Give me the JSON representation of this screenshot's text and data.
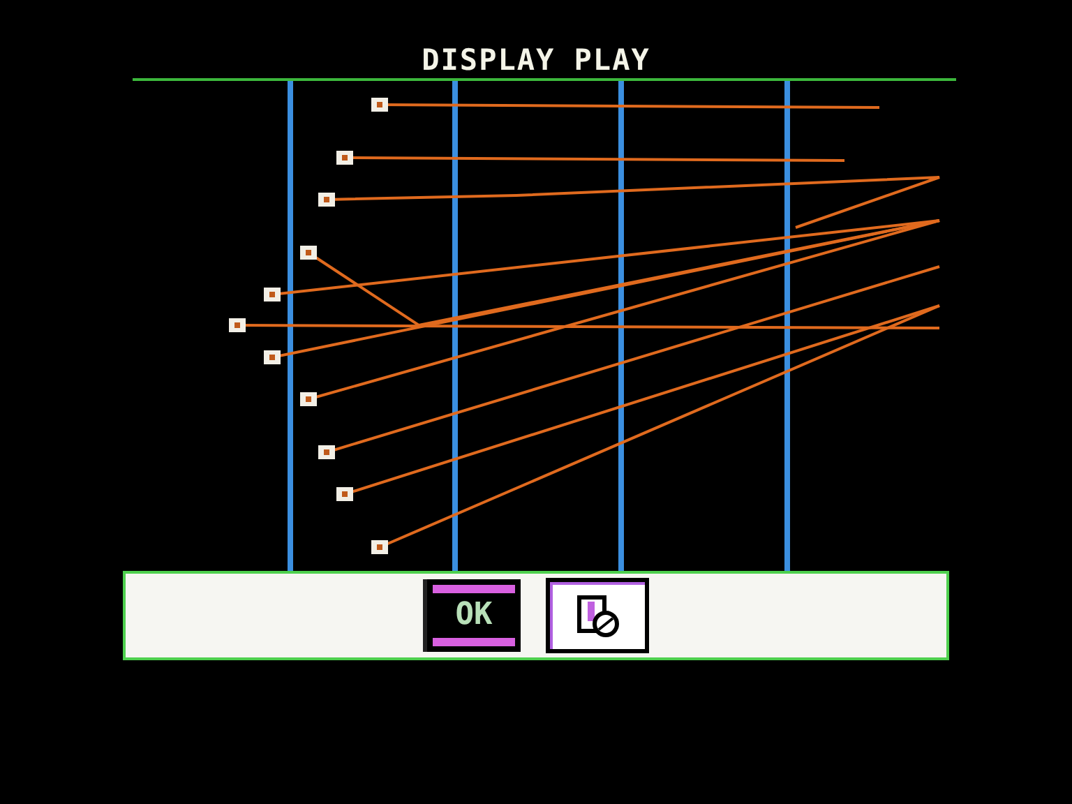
{
  "title": "DISPLAY PLAY",
  "buttons": [
    {
      "kind": "text",
      "label": "OK"
    },
    {
      "kind": "icon"
    }
  ]
}
